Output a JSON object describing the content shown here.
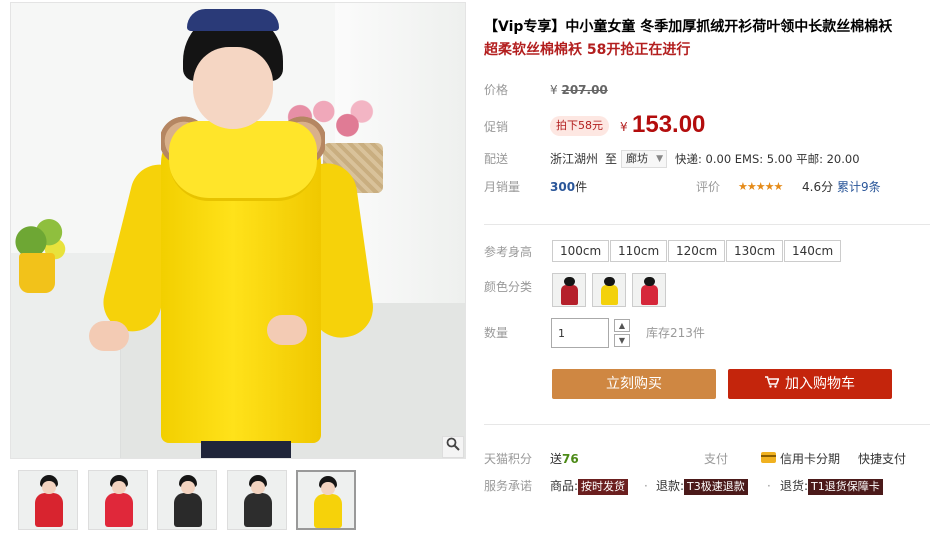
{
  "gallery": {
    "zoom_icon": "magnifier-icon",
    "thumbnails": [
      {
        "coat_color": "#d8242f"
      },
      {
        "coat_color": "#e0283a"
      },
      {
        "coat_color": "#2a2a2a"
      },
      {
        "coat_color": "#2d2d2d"
      },
      {
        "coat_color": "#f6d20a"
      }
    ],
    "active_thumbnail": 4
  },
  "product": {
    "title": "【Vip专享】中小童女童 冬季加厚抓绒开衫荷叶领中长款丝棉棉袄",
    "subtitle": "超柔软丝棉棉袄 58开抢正在进行"
  },
  "price": {
    "label": "价格",
    "currency": "¥",
    "original": "207.00"
  },
  "promo": {
    "label": "促销",
    "tag": "拍下58元",
    "currency": "¥",
    "price": "153.00"
  },
  "shipping": {
    "label": "配送",
    "from": "浙江湖州",
    "to_word": "至",
    "destination": "廊坊",
    "fees": "快递: 0.00 EMS: 5.00 平邮: 20.00"
  },
  "sales": {
    "label": "月销量",
    "count": "300",
    "unit": "件",
    "rating_label": "评价",
    "stars": "★★★★★",
    "score": "4.6分",
    "review_count": "累计9条"
  },
  "options": {
    "size_label": "参考身高",
    "sizes": [
      "100cm",
      "110cm",
      "120cm",
      "130cm",
      "140cm"
    ],
    "color_label": "颜色分类",
    "colors": [
      {
        "swatch": "#b5202b"
      },
      {
        "swatch": "#f3d10b"
      },
      {
        "swatch": "#d6273a"
      }
    ]
  },
  "quantity": {
    "label": "数量",
    "value": "1",
    "up_icon": "▲",
    "down_icon": "▼",
    "stock": "库存213件"
  },
  "actions": {
    "buy_now": "立刻购买",
    "add_to_cart": "加入购物车",
    "cart_icon": "cart-icon"
  },
  "points": {
    "label": "天猫积分",
    "prefix": "送",
    "value": "76",
    "pay_label": "支付",
    "installment": "信用卡分期",
    "quick_pay": "快捷支付"
  },
  "service": {
    "label": "服务承诺",
    "goods_prefix": "商品:",
    "goods_tag": "按时发货",
    "refund_prefix": "退款:",
    "refund_tag": "T3极速退款",
    "return_prefix": "退货:",
    "return_tag": "T1退货保障卡",
    "separator": "·"
  }
}
